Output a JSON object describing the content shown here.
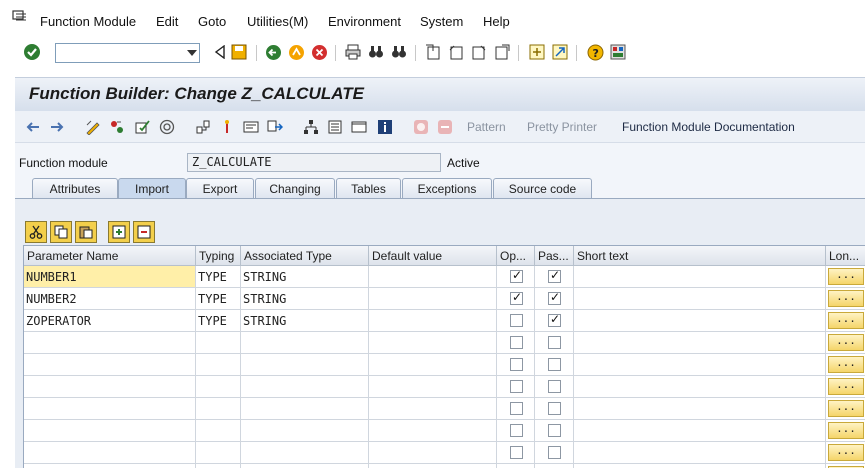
{
  "menu": {
    "items": [
      "Function Module",
      "Edit",
      "Goto",
      "Utilities(M)",
      "Environment",
      "System",
      "Help"
    ]
  },
  "title": "Function Builder: Change Z_CALCULATE",
  "app_toolbar": {
    "pattern": "Pattern",
    "pretty_printer": "Pretty Printer",
    "documentation": "Function Module Documentation"
  },
  "header": {
    "function_module_label": "Function module",
    "function_module_value": "Z_CALCULATE",
    "status": "Active"
  },
  "tabs": [
    "Attributes",
    "Import",
    "Export",
    "Changing",
    "Tables",
    "Exceptions",
    "Source code"
  ],
  "active_tab": "Import",
  "table": {
    "columns": [
      "Parameter Name",
      "Typing",
      "Associated Type",
      "Default value",
      "Op...",
      "Pas...",
      "Short text",
      "Lon..."
    ],
    "rows": [
      {
        "name": "NUMBER1",
        "typing": "TYPE",
        "assoc": "STRING",
        "default": "",
        "optional": true,
        "pass_value": true,
        "short_text": ""
      },
      {
        "name": "NUMBER2",
        "typing": "TYPE",
        "assoc": "STRING",
        "default": "",
        "optional": true,
        "pass_value": true,
        "short_text": ""
      },
      {
        "name": "ZOPERATOR",
        "typing": "TYPE",
        "assoc": "STRING",
        "default": "",
        "optional": false,
        "pass_value": true,
        "short_text": ""
      },
      {
        "name": "",
        "typing": "",
        "assoc": "",
        "default": "",
        "optional": false,
        "pass_value": false,
        "short_text": ""
      },
      {
        "name": "",
        "typing": "",
        "assoc": "",
        "default": "",
        "optional": false,
        "pass_value": false,
        "short_text": ""
      },
      {
        "name": "",
        "typing": "",
        "assoc": "",
        "default": "",
        "optional": false,
        "pass_value": false,
        "short_text": ""
      },
      {
        "name": "",
        "typing": "",
        "assoc": "",
        "default": "",
        "optional": false,
        "pass_value": false,
        "short_text": ""
      },
      {
        "name": "",
        "typing": "",
        "assoc": "",
        "default": "",
        "optional": false,
        "pass_value": false,
        "short_text": ""
      },
      {
        "name": "",
        "typing": "",
        "assoc": "",
        "default": "",
        "optional": false,
        "pass_value": false,
        "short_text": ""
      },
      {
        "name": "",
        "typing": "",
        "assoc": "",
        "default": "",
        "optional": false,
        "pass_value": false,
        "short_text": ""
      }
    ],
    "long_text_button": "..."
  },
  "colors": {
    "title_bg": "#dbe3ee",
    "selected_cell": "#ffefa8",
    "accent_yellow": "#f3cf4b"
  }
}
